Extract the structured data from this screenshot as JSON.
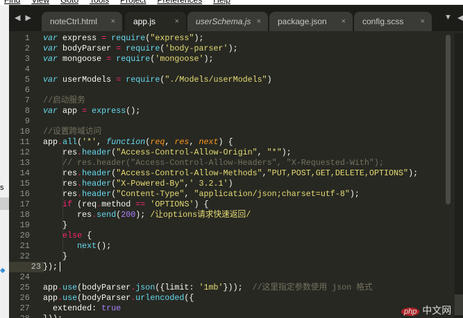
{
  "menu": [
    "Find",
    "View",
    "Goto",
    "Tools",
    "Project",
    "Preferences",
    "Help"
  ],
  "left_panel": {
    "fragment": "s"
  },
  "tabs": [
    {
      "label": "noteCtrl.html",
      "active": false,
      "italic": false
    },
    {
      "label": "app.js",
      "active": true,
      "italic": false
    },
    {
      "label": "userSchema.js",
      "active": false,
      "italic": true
    },
    {
      "label": "package.json",
      "active": false,
      "italic": false
    },
    {
      "label": "config.scss",
      "active": false,
      "italic": false
    }
  ],
  "tab_close_glyph": "×",
  "current_line": 23,
  "lines": [
    [
      [
        "kw",
        "var"
      ],
      [
        "pl",
        " express "
      ],
      [
        "op",
        "="
      ],
      [
        "pl",
        " "
      ],
      [
        "fn",
        "require"
      ],
      [
        "pl",
        "("
      ],
      [
        "str",
        "\"express\""
      ],
      [
        "pl",
        ");"
      ]
    ],
    [
      [
        "kw",
        "var"
      ],
      [
        "pl",
        " bodyParser "
      ],
      [
        "op",
        "="
      ],
      [
        "pl",
        " "
      ],
      [
        "fn",
        "require"
      ],
      [
        "pl",
        "("
      ],
      [
        "str",
        "'body-parser'"
      ],
      [
        "pl",
        ");"
      ]
    ],
    [
      [
        "kw",
        "var"
      ],
      [
        "pl",
        " mongoose "
      ],
      [
        "op",
        "="
      ],
      [
        "pl",
        " "
      ],
      [
        "fn",
        "require"
      ],
      [
        "pl",
        "("
      ],
      [
        "str",
        "'mongoose'"
      ],
      [
        "pl",
        ");"
      ]
    ],
    [],
    [
      [
        "kw",
        "var"
      ],
      [
        "pl",
        " userModels "
      ],
      [
        "op",
        "="
      ],
      [
        "pl",
        " "
      ],
      [
        "fn",
        "require"
      ],
      [
        "pl",
        "("
      ],
      [
        "str",
        "\"./Models/userModels\""
      ],
      [
        "pl",
        ")"
      ]
    ],
    [],
    [
      [
        "cm",
        "//启动服务"
      ]
    ],
    [
      [
        "kw",
        "var"
      ],
      [
        "pl",
        " app "
      ],
      [
        "op",
        "="
      ],
      [
        "pl",
        " "
      ],
      [
        "fn",
        "express"
      ],
      [
        "pl",
        "();"
      ]
    ],
    [],
    [
      [
        "cm",
        "//设置跨域访问"
      ]
    ],
    [
      [
        "pl",
        "app"
      ],
      [
        "op",
        "."
      ],
      [
        "fn",
        "all"
      ],
      [
        "pl",
        "("
      ],
      [
        "str",
        "'*'"
      ],
      [
        "pl",
        ", "
      ],
      [
        "kw",
        "function"
      ],
      [
        "pl",
        "("
      ],
      [
        "par",
        "req"
      ],
      [
        "pl",
        ", "
      ],
      [
        "par",
        "res"
      ],
      [
        "pl",
        ", "
      ],
      [
        "par",
        "next"
      ],
      [
        "pl",
        ") {"
      ]
    ],
    [
      [
        "pl",
        "    res"
      ],
      [
        "op",
        "."
      ],
      [
        "fn",
        "header"
      ],
      [
        "pl",
        "("
      ],
      [
        "str",
        "\"Access-Control-Allow-Origin\""
      ],
      [
        "pl",
        ", "
      ],
      [
        "str",
        "\"*\""
      ],
      [
        "pl",
        ");"
      ]
    ],
    [
      [
        "cm",
        "    // res.header(\"Access-Control-Allow-Headers\", \"X-Requested-With\");"
      ]
    ],
    [
      [
        "pl",
        "    res"
      ],
      [
        "op",
        "."
      ],
      [
        "fn",
        "header"
      ],
      [
        "pl",
        "("
      ],
      [
        "str",
        "\"Access-Control-Allow-Methods\""
      ],
      [
        "pl",
        ","
      ],
      [
        "str",
        "\"PUT,POST,GET,DELETE,OPTIONS\""
      ],
      [
        "pl",
        ");"
      ]
    ],
    [
      [
        "pl",
        "    res"
      ],
      [
        "op",
        "."
      ],
      [
        "fn",
        "header"
      ],
      [
        "pl",
        "("
      ],
      [
        "str",
        "\"X-Powered-By\""
      ],
      [
        "pl",
        ","
      ],
      [
        "str",
        "' 3.2.1'"
      ],
      [
        "pl",
        ")"
      ]
    ],
    [
      [
        "pl",
        "    res"
      ],
      [
        "op",
        "."
      ],
      [
        "fn",
        "header"
      ],
      [
        "pl",
        "("
      ],
      [
        "str",
        "\"Content-Type\""
      ],
      [
        "pl",
        ", "
      ],
      [
        "str",
        "\"application/json;charset=utf-8\""
      ],
      [
        "pl",
        ");"
      ]
    ],
    [
      [
        "ctl",
        "    if"
      ],
      [
        "pl",
        " (req"
      ],
      [
        "op",
        "."
      ],
      [
        "pl",
        "method "
      ],
      [
        "op",
        "=="
      ],
      [
        "pl",
        " "
      ],
      [
        "str",
        "'OPTIONS'"
      ],
      [
        "pl",
        ") {"
      ]
    ],
    [
      [
        "pl",
        "       res"
      ],
      [
        "op",
        "."
      ],
      [
        "fn",
        "send"
      ],
      [
        "pl",
        "("
      ],
      [
        "num",
        "200"
      ],
      [
        "pl",
        ");"
      ],
      [
        "str",
        " /让options请求快速返回/"
      ]
    ],
    [
      [
        "pl",
        "    }"
      ]
    ],
    [
      [
        "ctl",
        "    else"
      ],
      [
        "pl",
        " {"
      ]
    ],
    [
      [
        "pl",
        "       "
      ],
      [
        "fn",
        "next"
      ],
      [
        "pl",
        "();"
      ]
    ],
    [
      [
        "pl",
        "    }"
      ]
    ],
    [
      [
        "pl",
        "});"
      ]
    ],
    [],
    [
      [
        "pl",
        "app"
      ],
      [
        "op",
        "."
      ],
      [
        "fn",
        "use"
      ],
      [
        "pl",
        "(bodyParser"
      ],
      [
        "op",
        "."
      ],
      [
        "fn",
        "json"
      ],
      [
        "pl",
        "({limit: "
      ],
      [
        "str",
        "'1mb'"
      ],
      [
        "pl",
        "}));  "
      ],
      [
        "cm",
        "//这里指定参数使用 json 格式"
      ]
    ],
    [
      [
        "pl",
        "app"
      ],
      [
        "op",
        "."
      ],
      [
        "fn",
        "use"
      ],
      [
        "pl",
        "(bodyParser"
      ],
      [
        "op",
        "."
      ],
      [
        "fn",
        "urlencoded"
      ],
      [
        "pl",
        "({"
      ]
    ],
    [
      [
        "pl",
        "  extended: "
      ],
      [
        "num",
        "true"
      ]
    ],
    [
      [
        "pl",
        "}));"
      ]
    ]
  ],
  "watermark": {
    "badge": "php",
    "text": "中文网"
  }
}
